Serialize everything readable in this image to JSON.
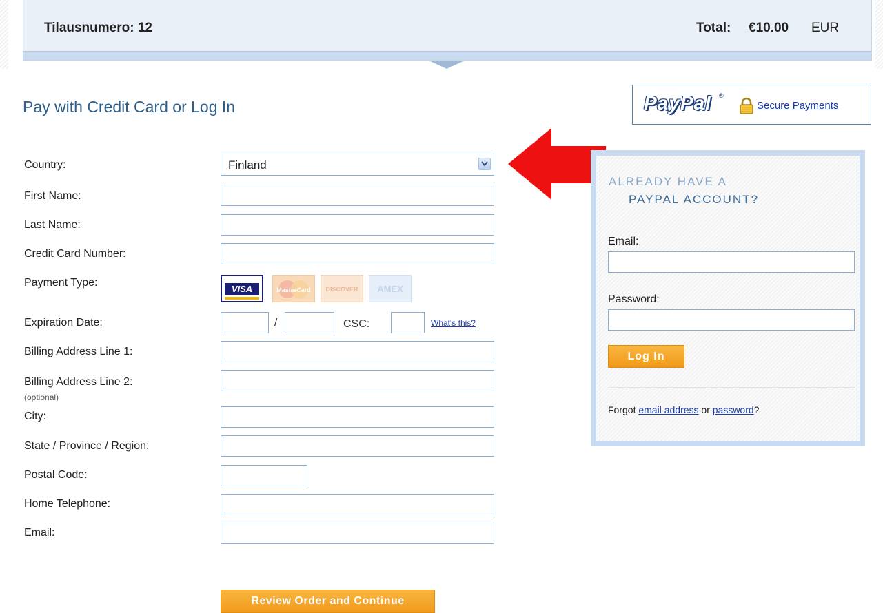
{
  "header": {
    "order_number": "Tilausnumero: 12",
    "total_label": "Total:",
    "total_amount": "€10.00",
    "total_currency": "EUR"
  },
  "page_title": "Pay with Credit Card or Log In",
  "badge": {
    "logo_text": "PayPal",
    "tm": "®",
    "secure_link": "Secure Payments",
    "lock_icon": "lock-icon"
  },
  "form": {
    "labels": {
      "country": "Country:",
      "first_name": "First Name:",
      "last_name": "Last Name:",
      "card_number": "Credit Card Number:",
      "payment_type": "Payment Type:",
      "expiration": "Expiration Date:",
      "billing1": "Billing Address Line 1:",
      "billing2": "Billing Address Line 2:",
      "billing2_note": "(optional)",
      "city": "City:",
      "state": "State / Province / Region:",
      "postal": "Postal Code:",
      "phone": "Home Telephone:",
      "email": "Email:"
    },
    "country_value": "Finland",
    "exp_slash": "/",
    "csc_label": "CSC:",
    "whats_this": "What's this?",
    "cards": {
      "visa": "VISA",
      "mastercard": "MasterCard",
      "discover": "DISCOVER",
      "amex": "AMEX"
    },
    "submit": "Review Order and Continue"
  },
  "login": {
    "title_line1": "ALREADY HAVE A",
    "title_line2": "PAYPAL ACCOUNT?",
    "email_label": "Email:",
    "password_label": "Password:",
    "button": "Log In",
    "forgot_prefix": "Forgot ",
    "forgot_email_link": "email address",
    "forgot_or": " or ",
    "forgot_password_link": "password",
    "forgot_suffix": "?"
  },
  "colors": {
    "brand_blue": "#2e5f8a",
    "link_blue": "#1a3cb0",
    "button_orange": "#f19a1a",
    "arrow_red": "#ee1111"
  }
}
